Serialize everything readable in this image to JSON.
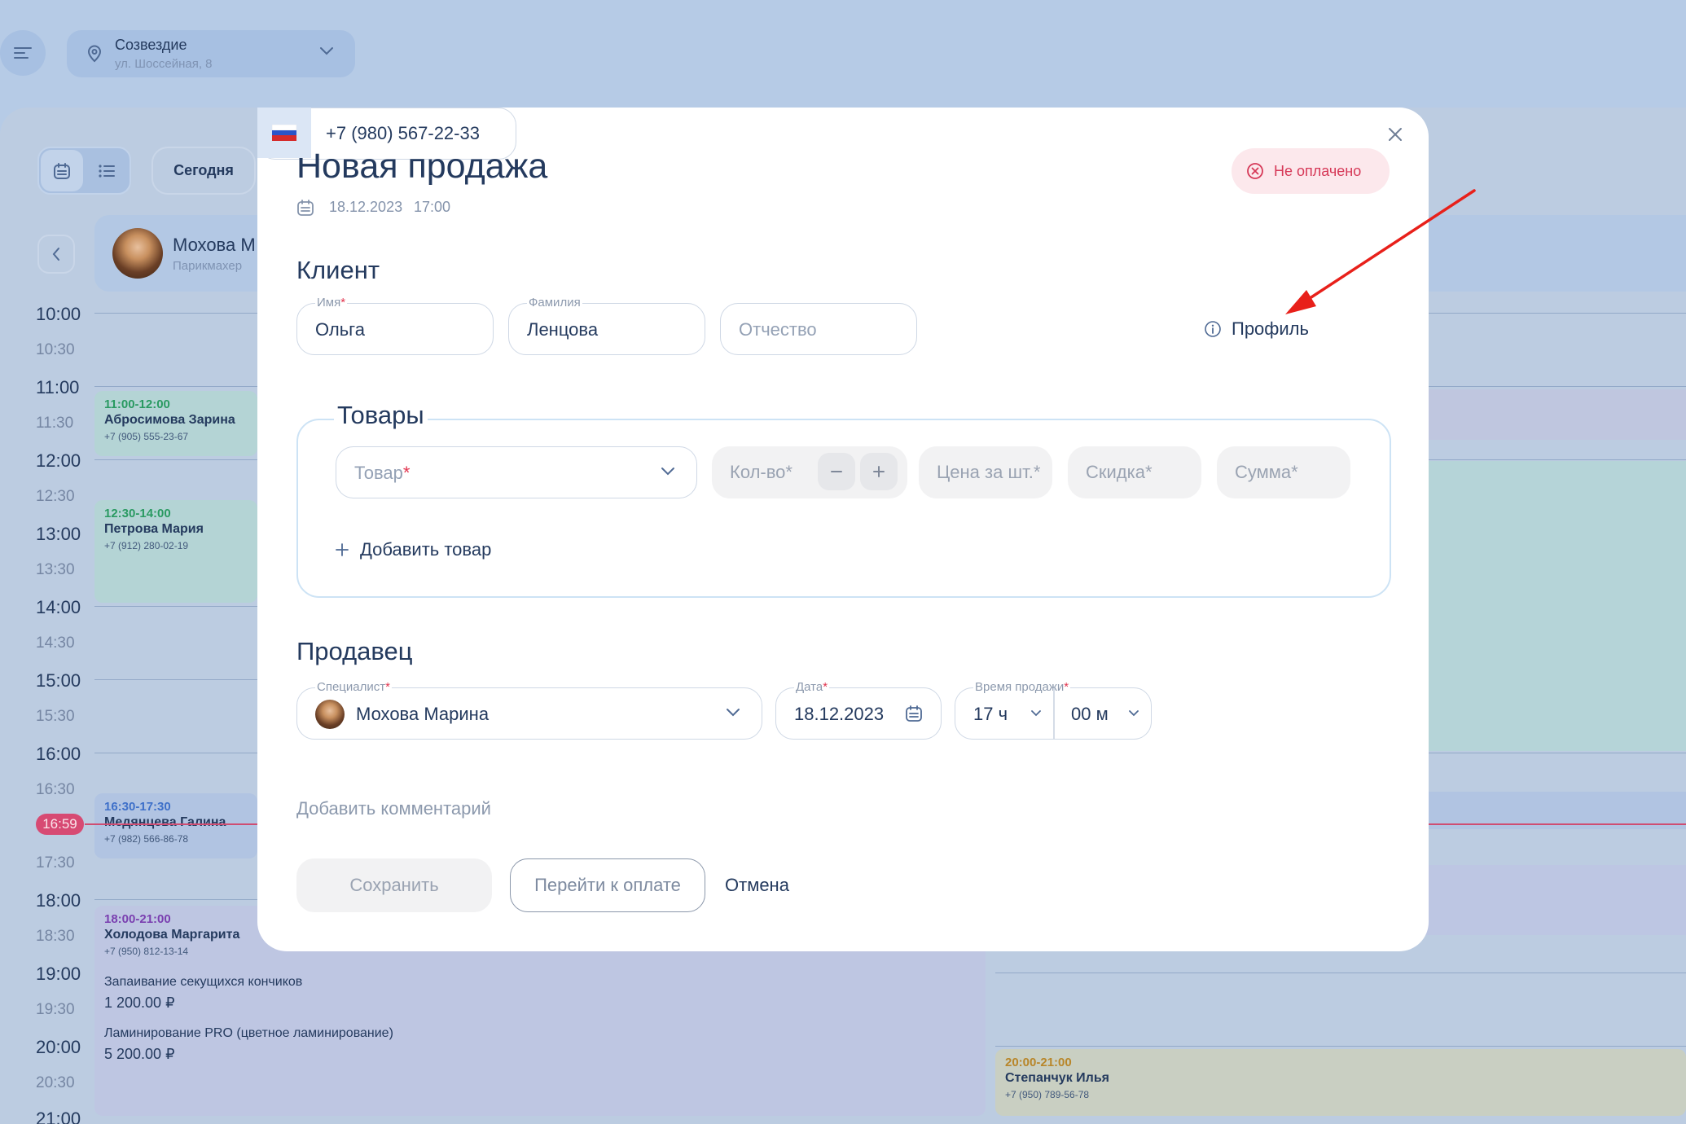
{
  "header": {
    "location_name": "Созвездие",
    "location_address": "ул. Шоссейная, 8"
  },
  "toolbar": {
    "today_label": "Сегодня"
  },
  "staff": {
    "name": "Мохова М",
    "role": "Парикмахер"
  },
  "timeline": {
    "slots": [
      "10:00",
      "10:30",
      "11:00",
      "11:30",
      "12:00",
      "12:30",
      "13:00",
      "13:30",
      "14:00",
      "14:30",
      "15:00",
      "15:30",
      "16:00",
      "16:30",
      "17:30",
      "18:00",
      "18:30",
      "19:00",
      "19:30",
      "20:00",
      "20:30",
      "21:00"
    ],
    "current_time": "16:59"
  },
  "events": [
    {
      "time": "11:00-12:00",
      "name": "Абросимова Зарина",
      "phone": "+7 (905) 555-23-67",
      "color": "#2a9a62"
    },
    {
      "time": "12:30-14:00",
      "name": "Петрова Мария",
      "phone": "+7 (912) 280-02-19",
      "color": "#2a9a62"
    },
    {
      "time": "16:30-17:30",
      "name": "Медянцева Галина",
      "phone": "+7 (982) 566-86-78",
      "color": "#3e70c9"
    },
    {
      "time": "18:00-21:00",
      "name": "Холодова Маргарита",
      "phone": "+7 (950) 812-13-14",
      "color": "#7a3fb0",
      "services": [
        {
          "name": "Запаивание секущихся кончиков",
          "price": "1 200.00 ₽"
        },
        {
          "name": "Ламинирование PRO (цветное ламинирование)",
          "price": "5 200.00 ₽"
        }
      ]
    },
    {
      "time": "20:00-21:00",
      "name": "Степанчук Илья",
      "phone": "+7 (950) 789-56-78",
      "color": "#b8862a"
    }
  ],
  "modal": {
    "title": "Новая продажа",
    "date": "18.12.2023",
    "time": "17:00",
    "status": "Не оплачено",
    "client": {
      "section_title": "Клиент",
      "first_name_label": "Имя",
      "first_name": "Ольга",
      "last_name_label": "Фамилия",
      "last_name": "Ленцова",
      "middle_name_placeholder": "Отчество",
      "phone": "+7 (980) 567-22-33",
      "profile_label": "Профиль"
    },
    "goods": {
      "section_title": "Товары",
      "product_placeholder": "Товар",
      "qty_placeholder": "Кол-во*",
      "price_placeholder": "Цена за шт.*",
      "discount_placeholder": "Скидка*",
      "sum_placeholder": "Сумма*",
      "add_label": "Добавить товар"
    },
    "seller": {
      "section_title": "Продавец",
      "specialist_label": "Специалист",
      "specialist": "Мохова Марина",
      "date_label": "Дата",
      "date": "18.12.2023",
      "time_label": "Время продажи",
      "hours": "17 ч",
      "minutes": "00 м"
    },
    "comment_label": "Добавить комментарий",
    "save_label": "Сохранить",
    "pay_label": "Перейти к оплате",
    "cancel_label": "Отмена"
  },
  "colors": {
    "accent": "#243a5e",
    "unpaid": "#d63857",
    "annotation_arrow": "#e8201a",
    "now_marker": "#d74a73"
  }
}
